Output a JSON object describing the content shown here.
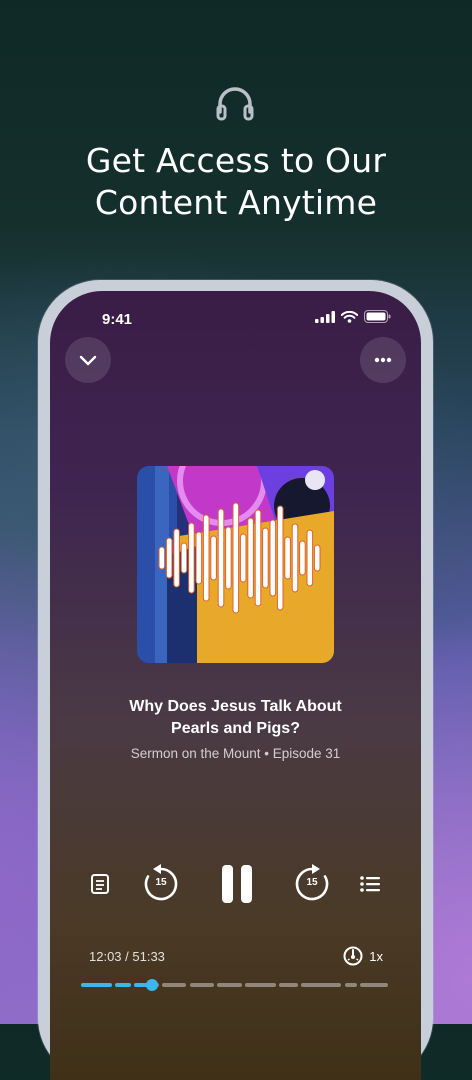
{
  "header": {
    "icon": "headphones-icon",
    "title": "Get Access to Our\nContent Anytime"
  },
  "status_bar": {
    "time": "9:41",
    "icons": [
      "cellular-signal-icon",
      "wifi-icon",
      "battery-icon"
    ]
  },
  "player": {
    "collapse_icon": "chevron-down-icon",
    "more_icon": "more-horizontal-icon",
    "episode_title": "Why Does Jesus Talk About\nPearls and Pigs?",
    "episode_subtitle": "Sermon on the Mount • Episode 31",
    "controls": {
      "transcript_icon": "transcript-icon",
      "skip_back_label": "15",
      "pause_icon": "pause-icon",
      "skip_forward_label": "15",
      "queue_icon": "list-icon"
    },
    "elapsed": "12:03 / 51:33",
    "speed_label": "1x",
    "speed_icon": "speedometer-icon",
    "progress_fraction": 0.23,
    "chapter_fractions": [
      0.11,
      0.17,
      0.23,
      0.26,
      0.35,
      0.44,
      0.53,
      0.64,
      0.71,
      0.85,
      0.9
    ],
    "accent_color": "#39b7ef"
  }
}
